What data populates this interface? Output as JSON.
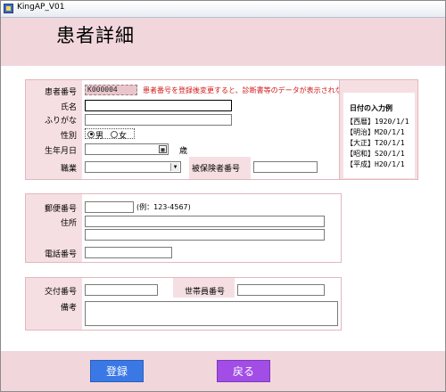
{
  "window": {
    "title": "KingAP_V01"
  },
  "page_title": "患者詳細",
  "patient": {
    "id_label": "患者番号",
    "id_value": "K000004",
    "warning": "患者番号を登録後変更すると、診断書等のデータが表示されなくなります。",
    "name_label": "氏名",
    "name_value": "",
    "furigana_label": "ふりがな",
    "furigana_value": "",
    "gender_label": "性別",
    "gender_options": [
      "男",
      "女"
    ],
    "gender_selected": "男",
    "birth_label": "生年月日",
    "birth_value": "",
    "age_unit": "歳",
    "job_label": "職業",
    "job_value": "",
    "insured_label": "被保険者番号",
    "insured_value": ""
  },
  "date_hint": {
    "title": "日付の入力例",
    "lines": [
      "【西暦】1920/1/1",
      "【明治】M20/1/1",
      "【大正】T20/1/1",
      "【昭和】S20/1/1",
      "【平成】H20/1/1"
    ]
  },
  "address": {
    "zip_label": "郵便番号",
    "zip_value": "",
    "zip_example": "(例：123-4567)",
    "addr_label": "住所",
    "addr_line1": "",
    "addr_line2": "",
    "phone_label": "電話番号",
    "phone_value": ""
  },
  "other": {
    "delivery_label": "交付番号",
    "delivery_value": "",
    "household_label": "世帯員番号",
    "household_value": "",
    "notes_label": "備考",
    "notes_value": ""
  },
  "buttons": {
    "register": "登録",
    "back": "戻る"
  },
  "colors": {
    "register": "#3a78e6",
    "back": "#a24de6",
    "warning": "#d21818"
  }
}
